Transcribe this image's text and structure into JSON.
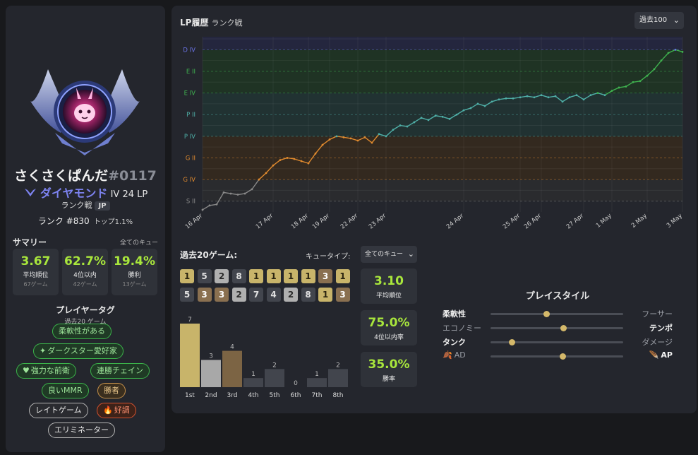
{
  "profile": {
    "name": "さくさくぱんだ",
    "tag": "#0117",
    "tier": "ダイヤモンド",
    "division": "IV",
    "lp": "24 LP",
    "queue": "ランク戦",
    "region": "JP",
    "ladder_rank": "ランク #830",
    "top_percent": "トップ1.1%"
  },
  "summary": {
    "title": "サマリー",
    "queue": "全てのキュー",
    "stats": [
      {
        "value": "3.67",
        "label": "平均順位",
        "sub": "67ゲーム"
      },
      {
        "value": "62.7%",
        "label": "4位以内",
        "sub": "42ゲーム"
      },
      {
        "value": "19.4%",
        "label": "勝利",
        "sub": "13ゲーム"
      }
    ]
  },
  "player_tags": {
    "title": "プレイヤータグ",
    "subtitle": "過去20 ゲーム",
    "tags": [
      {
        "label": "柔軟性がある",
        "icon": "",
        "style": "g"
      },
      {
        "label": "ダークスター愛好家",
        "icon": "star-icon",
        "style": "g"
      },
      {
        "label": "強力な前衛",
        "icon": "heart-icon",
        "style": "g"
      },
      {
        "label": "連勝チェイン",
        "icon": "",
        "style": "g"
      },
      {
        "label": "良いMMR",
        "icon": "",
        "style": "g"
      },
      {
        "label": "勝者",
        "icon": "",
        "style": "o"
      },
      {
        "label": "レイトゲーム",
        "icon": "",
        "style": "w"
      },
      {
        "label": "好調",
        "icon": "fire-icon",
        "style": "r"
      },
      {
        "label": "エリミネーター",
        "icon": "",
        "style": "w"
      }
    ]
  },
  "lp_history": {
    "title": "LP履歴",
    "subtitle": "ランク戦",
    "range": "過去100"
  },
  "chart_data": {
    "type": "line",
    "y_ticks": [
      "S II",
      "G IV",
      "G II",
      "P IV",
      "P II",
      "E IV",
      "E II",
      "D IV"
    ],
    "x_ticks": [
      "16 Apr",
      "17 Apr",
      "18 Apr",
      "19 Apr",
      "22 Apr",
      "23 Apr",
      "24 Apr",
      "25 Apr",
      "26 Apr",
      "27 Apr",
      "1 May",
      "2 May",
      "3 May"
    ],
    "x_tick_positions": [
      0,
      10,
      15,
      18,
      22,
      26,
      37,
      45,
      48,
      54,
      58,
      63,
      68
    ],
    "x_range": [
      0,
      68
    ],
    "y_range": [
      -0.5,
      7.6
    ],
    "band_colors": [
      "#8a8a8a",
      "#e08a2e",
      "#e08a2e",
      "#4fb0a8",
      "#4fb0a8",
      "#3fb34f",
      "#3fb34f",
      "#6b74e8"
    ],
    "values": [
      -0.4,
      -0.2,
      -0.15,
      0.4,
      0.35,
      0.3,
      0.35,
      0.55,
      1.0,
      1.3,
      1.65,
      1.9,
      2.0,
      1.95,
      1.85,
      1.75,
      2.2,
      2.6,
      2.85,
      3.0,
      2.95,
      2.9,
      2.8,
      2.95,
      2.7,
      3.1,
      3.0,
      3.3,
      3.5,
      3.45,
      3.65,
      3.85,
      3.75,
      3.95,
      3.9,
      3.8,
      4.0,
      4.2,
      4.3,
      4.5,
      4.4,
      4.6,
      4.7,
      4.75,
      4.75,
      4.8,
      4.85,
      4.8,
      4.9,
      4.8,
      4.85,
      4.6,
      4.8,
      4.9,
      4.7,
      4.9,
      5.0,
      4.9,
      5.1,
      5.25,
      5.3,
      5.5,
      5.55,
      5.8,
      6.1,
      6.5,
      6.85,
      7.0,
      6.9
    ]
  },
  "games": {
    "title": "過去20ゲーム:",
    "queue_type_label": "キュータイプ:",
    "queue_type_value": "全てのキュー",
    "placements": [
      1,
      5,
      2,
      8,
      1,
      1,
      1,
      1,
      3,
      1,
      5,
      3,
      3,
      2,
      7,
      4,
      2,
      8,
      1,
      3
    ],
    "stats": [
      {
        "value": "3.10",
        "label": "平均順位"
      },
      {
        "value": "75.0%",
        "label": "4位以内率"
      },
      {
        "value": "35.0%",
        "label": "勝率"
      }
    ],
    "histogram": {
      "categories": [
        "1st",
        "2nd",
        "3rd",
        "4th",
        "5th",
        "6th",
        "7th",
        "8th"
      ],
      "values": [
        7,
        3,
        4,
        1,
        2,
        0,
        1,
        2
      ]
    }
  },
  "playstyle": {
    "title": "プレイスタイル",
    "rows": [
      {
        "left": "柔軟性",
        "right": "フーサー",
        "value": 0.42,
        "left_on": true,
        "left_icon": "",
        "right_icon": ""
      },
      {
        "left": "エコノミー",
        "right": "テンポ",
        "value": 0.55,
        "left_on": false,
        "left_icon": "",
        "right_icon": ""
      },
      {
        "left": "タンク",
        "right": "ダメージ",
        "value": 0.16,
        "left_on": true,
        "left_icon": "",
        "right_icon": ""
      },
      {
        "left": "AD",
        "right": "AP",
        "value": 0.54,
        "left_on": false,
        "left_icon": "ad-icon",
        "right_icon": "ap-icon"
      }
    ]
  }
}
